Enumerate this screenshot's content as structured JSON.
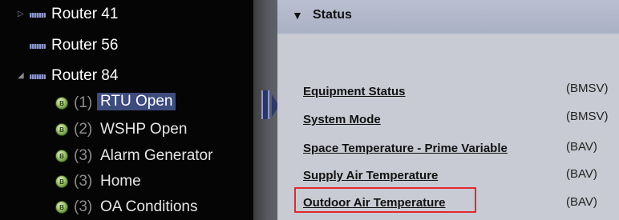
{
  "tree": {
    "routers": [
      {
        "label": "Router 41",
        "expander": "▷"
      },
      {
        "label": "Router 56",
        "expander": ""
      },
      {
        "label": "Router 84",
        "expander": "◢"
      }
    ],
    "devices": [
      {
        "index": "(1)",
        "label": "RTU Open",
        "selected": true
      },
      {
        "index": "(2)",
        "label": "WSHP Open",
        "selected": false
      },
      {
        "index": "(3)",
        "label": "Alarm Generator",
        "selected": false
      },
      {
        "index": "(3)",
        "label": "Home",
        "selected": false
      },
      {
        "index": "(3)",
        "label": "OA Conditions",
        "selected": false
      }
    ],
    "device_icon_glyph": "B"
  },
  "status": {
    "caret": "▼",
    "title": "Status",
    "properties": [
      {
        "label": "Equipment Status",
        "type": "(BMSV)"
      },
      {
        "label": "System Mode",
        "type": "(BMSV)"
      },
      {
        "label": "Space Temperature - Prime Variable",
        "type": "(BAV)"
      },
      {
        "label": "Supply Air Temperature",
        "type": "(BAV)"
      },
      {
        "label": "Outdoor Air Temperature",
        "type": "(BAV)",
        "highlighted": true
      }
    ]
  },
  "colors": {
    "highlight": "#e0282e",
    "selection": "#3d4b7d",
    "tree_bg": "#050505",
    "panel_bg": "#c8cbd3"
  }
}
